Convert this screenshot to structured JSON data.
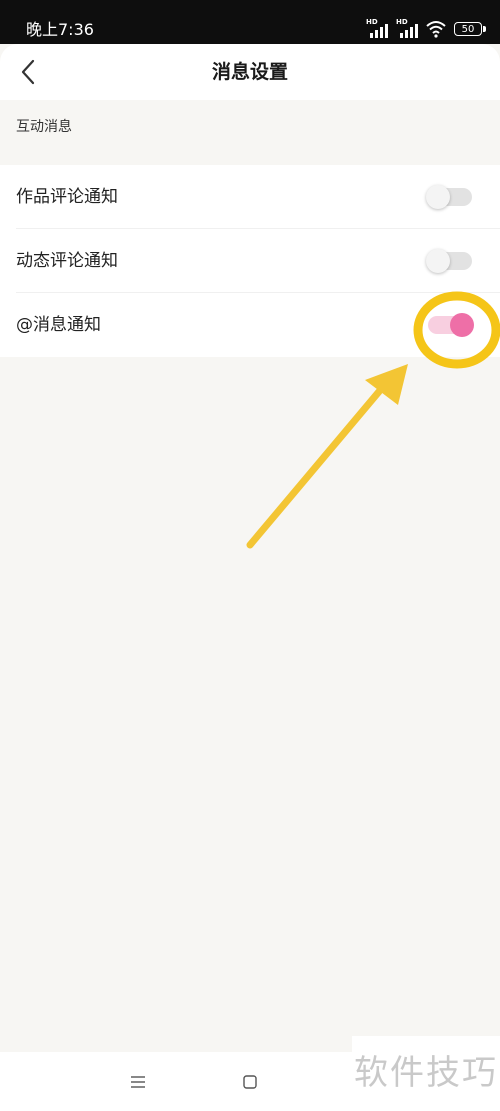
{
  "status_bar": {
    "time": "晚上7:36",
    "signal_1_label": "HD",
    "signal_2_label": "HD",
    "battery": "50",
    "icons": [
      "signal-icon",
      "signal-icon",
      "wifi-icon",
      "battery-icon"
    ]
  },
  "header": {
    "title": "消息设置",
    "back_icon": "chevron-left-icon"
  },
  "section": {
    "title": "互动消息"
  },
  "settings": [
    {
      "label": "作品评论通知",
      "enabled": false
    },
    {
      "label": "动态评论通知",
      "enabled": false
    },
    {
      "label": "@消息通知",
      "enabled": true
    }
  ],
  "colors": {
    "accent_pink": "#ee6fa7",
    "annotation_yellow": "#f5c518"
  },
  "system_nav": {
    "icons": [
      "menu-icon",
      "home-square-icon"
    ]
  },
  "watermark": {
    "text": "软件技巧"
  }
}
